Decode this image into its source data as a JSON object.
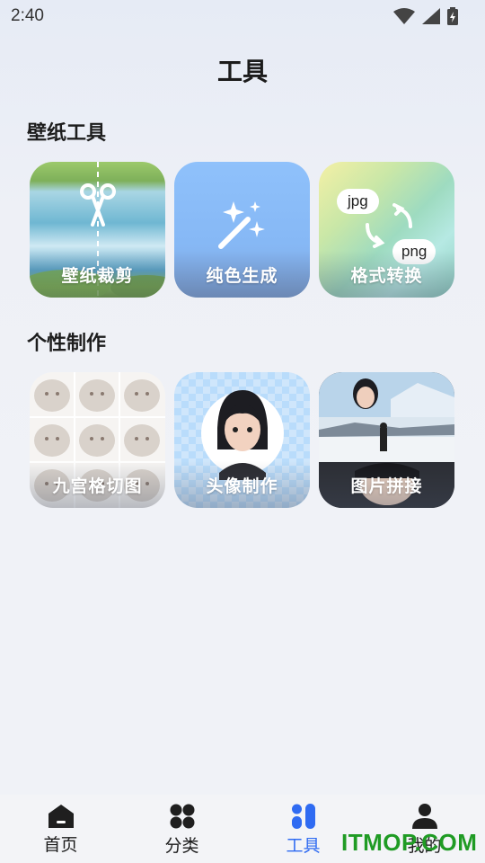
{
  "status_bar": {
    "time": "2:40"
  },
  "page": {
    "title": "工具"
  },
  "sections": [
    {
      "title": "壁纸工具",
      "cards": [
        {
          "label": "壁纸裁剪",
          "icon": "scissors-icon"
        },
        {
          "label": "纯色生成",
          "icon": "magic-wand-icon"
        },
        {
          "label": "格式转换",
          "icon": "format-convert-icon",
          "badge_from": "jpg",
          "badge_to": "png"
        }
      ]
    },
    {
      "title": "个性制作",
      "cards": [
        {
          "label": "九宫格切图",
          "icon": "cat-grid-image"
        },
        {
          "label": "头像制作",
          "icon": "avatar-portrait-image"
        },
        {
          "label": "图片拼接",
          "icon": "stitched-photo-image"
        }
      ]
    }
  ],
  "tab_bar": {
    "items": [
      {
        "label": "首页",
        "icon": "home-icon",
        "active": false
      },
      {
        "label": "分类",
        "icon": "category-icon",
        "active": false
      },
      {
        "label": "工具",
        "icon": "tools-icon",
        "active": true
      },
      {
        "label": "我的",
        "icon": "profile-icon",
        "active": false
      }
    ],
    "active_color": "#2f6bf2"
  },
  "watermark": "ITMOP.COM"
}
